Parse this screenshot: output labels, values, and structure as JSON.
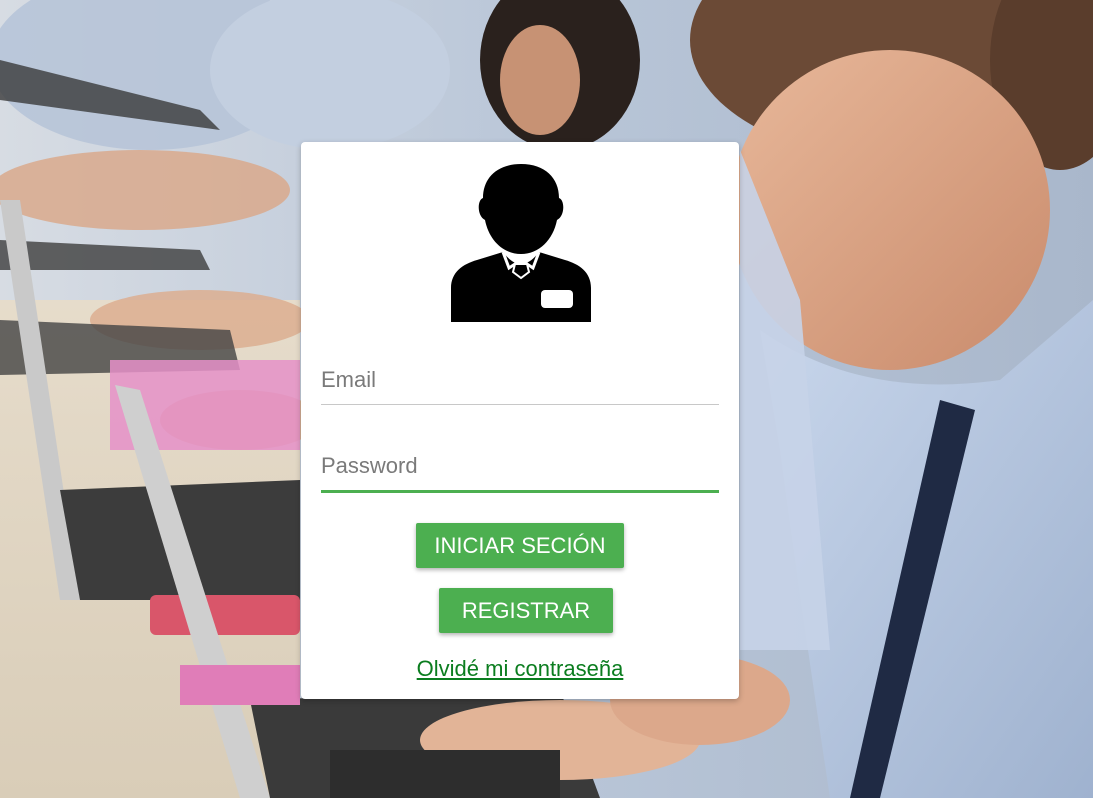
{
  "login": {
    "email_placeholder": "Email",
    "password_placeholder": "Password",
    "login_button": "INICIAR SECIÓN",
    "register_button": "REGISTRAR",
    "forgot_link": "Olvidé mi contraseña"
  },
  "icons": {
    "avatar": "user-avatar-icon"
  },
  "colors": {
    "accent": "#4caf50",
    "link": "#0b7d1f",
    "card": "#ffffff"
  }
}
